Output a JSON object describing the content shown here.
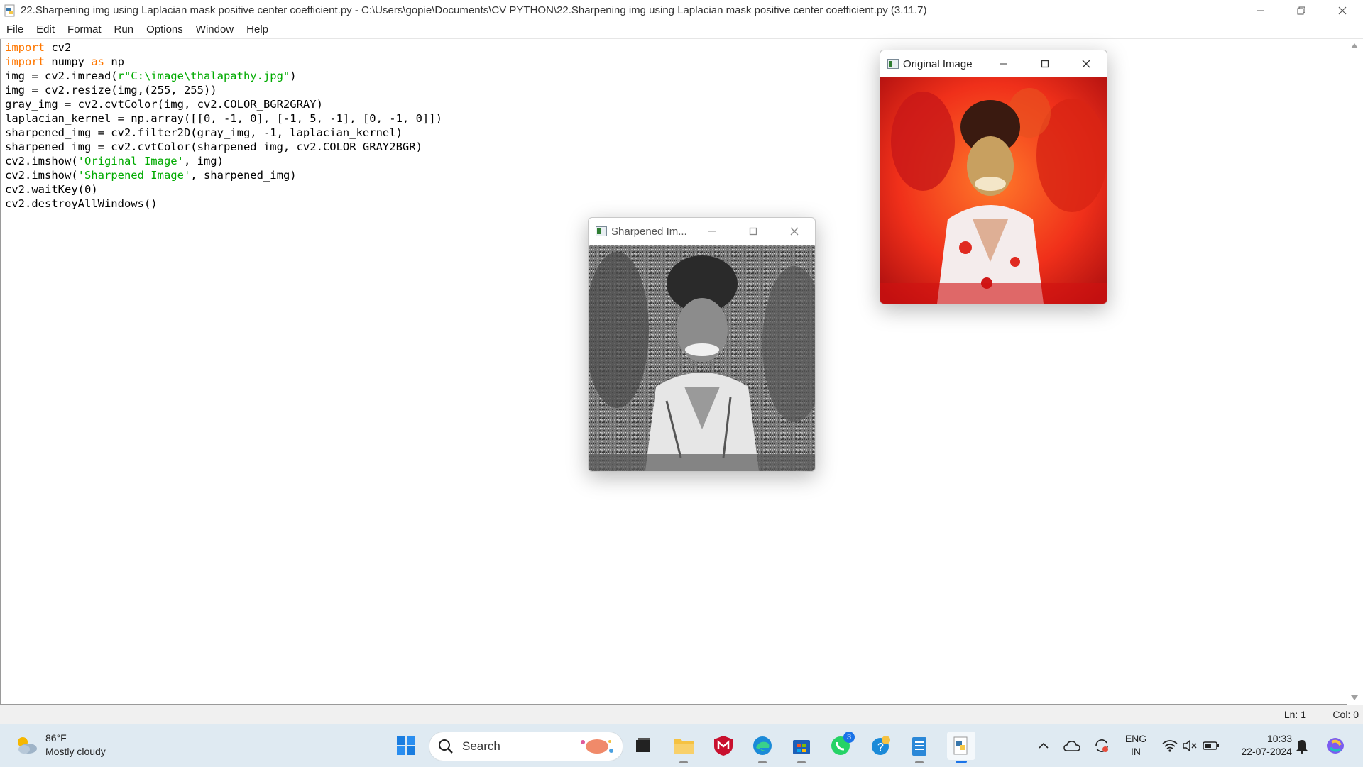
{
  "window": {
    "title": "22.Sharpening img using Laplacian mask positive center coefficient.py - C:\\Users\\gopie\\Documents\\CV PYTHON\\22.Sharpening img using Laplacian mask positive center coefficient.py (3.11.7)"
  },
  "menu": [
    "File",
    "Edit",
    "Format",
    "Run",
    "Options",
    "Window",
    "Help"
  ],
  "code_lines": [
    [
      {
        "t": "import",
        "c": "kw"
      },
      {
        "t": " cv2"
      }
    ],
    [
      {
        "t": "import",
        "c": "kw"
      },
      {
        "t": " numpy "
      },
      {
        "t": "as",
        "c": "kw"
      },
      {
        "t": " np"
      }
    ],
    [
      {
        "t": "img = cv2.imread("
      },
      {
        "t": "r\"C:\\image\\thalapathy.jpg\"",
        "c": "str"
      },
      {
        "t": ")"
      }
    ],
    [
      {
        "t": "img = cv2.resize(img,(255, 255))"
      }
    ],
    [
      {
        "t": "gray_img = cv2.cvtColor(img, cv2.COLOR_BGR2GRAY)"
      }
    ],
    [
      {
        "t": "laplacian_kernel = np.array([[0, -1, 0], [-1, 5, -1], [0, -1, 0]])"
      }
    ],
    [
      {
        "t": "sharpened_img = cv2.filter2D(gray_img, -1, laplacian_kernel)"
      }
    ],
    [
      {
        "t": "sharpened_img = cv2.cvtColor(sharpened_img, cv2.COLOR_GRAY2BGR)"
      }
    ],
    [
      {
        "t": "cv2.imshow("
      },
      {
        "t": "'Original Image'",
        "c": "str"
      },
      {
        "t": ", img)"
      }
    ],
    [
      {
        "t": "cv2.imshow("
      },
      {
        "t": "'Sharpened Image'",
        "c": "str"
      },
      {
        "t": ", sharpened_img)"
      }
    ],
    [
      {
        "t": "cv2.waitKey(0)"
      }
    ],
    [
      {
        "t": "cv2.destroyAllWindows()"
      }
    ]
  ],
  "status": {
    "line": "Ln: 1",
    "col": "Col: 0"
  },
  "original_window": {
    "title": "Original Image"
  },
  "sharpened_window": {
    "title": "Sharpened Im..."
  },
  "taskbar": {
    "weather_temp": "86°F",
    "weather_desc": "Mostly cloudy",
    "search_label": "Search",
    "whatsapp_badge": "3",
    "lang_line1": "ENG",
    "lang_line2": "IN",
    "time": "10:33",
    "date": "22-07-2024"
  },
  "icons": {
    "app": "python-file-icon",
    "start": "windows-start-icon",
    "explorer": "file-explorer-icon",
    "edge": "edge-browser-icon",
    "store": "microsoft-store-icon",
    "whatsapp": "whatsapp-icon",
    "mcafee": "mcafee-icon"
  }
}
